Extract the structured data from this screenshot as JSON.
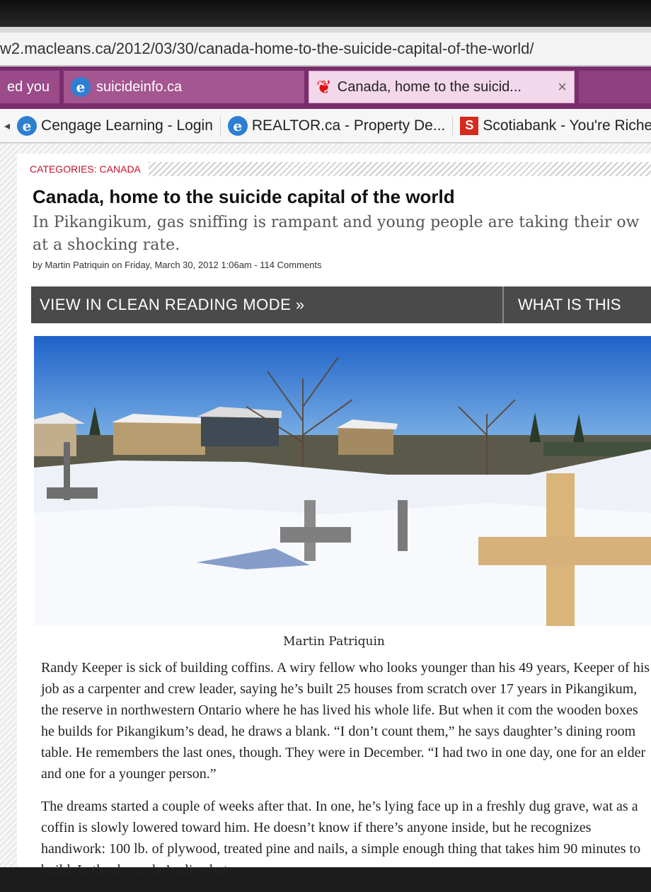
{
  "browser": {
    "url": "w2.macleans.ca/2012/03/30/canada-home-to-the-suicide-capital-of-the-world/",
    "tabs": [
      {
        "label": "ed you"
      },
      {
        "label": "suicideinfo.ca"
      },
      {
        "label": "Canada, home to the suicid...",
        "close": "×"
      }
    ],
    "bookmarks": [
      {
        "label": "Cengage Learning - Login"
      },
      {
        "label": "REALTOR.ca - Property De..."
      },
      {
        "label": "Scotiabank - You're Riche"
      }
    ]
  },
  "article": {
    "category_label": "CATEGORIES:",
    "category": "CANADA",
    "title": "Canada, home to the suicide capital of the world",
    "dek": "In Pikangikum, gas sniffing is rampant and young people are taking their ow at a shocking rate.",
    "byline": "by Martin Patriquin on Friday, March 30, 2012 1:06am - 114 Comments",
    "clean_mode": "VIEW IN CLEAN READING MODE »",
    "what_is_this": "WHAT IS THIS",
    "photo_caption": "Martin Patriquin",
    "paragraphs": [
      "Randy Keeper is sick of building coffins. A wiry fellow who looks younger than his 49 years, Keeper of his job as a carpenter and crew leader, saying he’s built 25 houses from scratch over 17 years in Pikangikum, the reserve in northwestern Ontario where he has lived his whole life. But when it com the wooden boxes he builds for Pikangikum’s dead, he draws a blank. “I don’t count them,” he says daughter’s dining room table. He remembers the last ones, though. They were in December. “I had two in one day, one for an elder and one for a younger person.”",
      "The dreams started a couple of weeks after that. In one, he’s lying face up in a freshly dug grave, wat as a coffin is slowly lowered toward him. He doesn’t know if there’s anyone inside, but he recognizes handiwork: 100 lb. of plywood, treated pine and nails, a simple enough thing that takes him 90 minutes to build. In the dream he’s alive but"
    ]
  }
}
